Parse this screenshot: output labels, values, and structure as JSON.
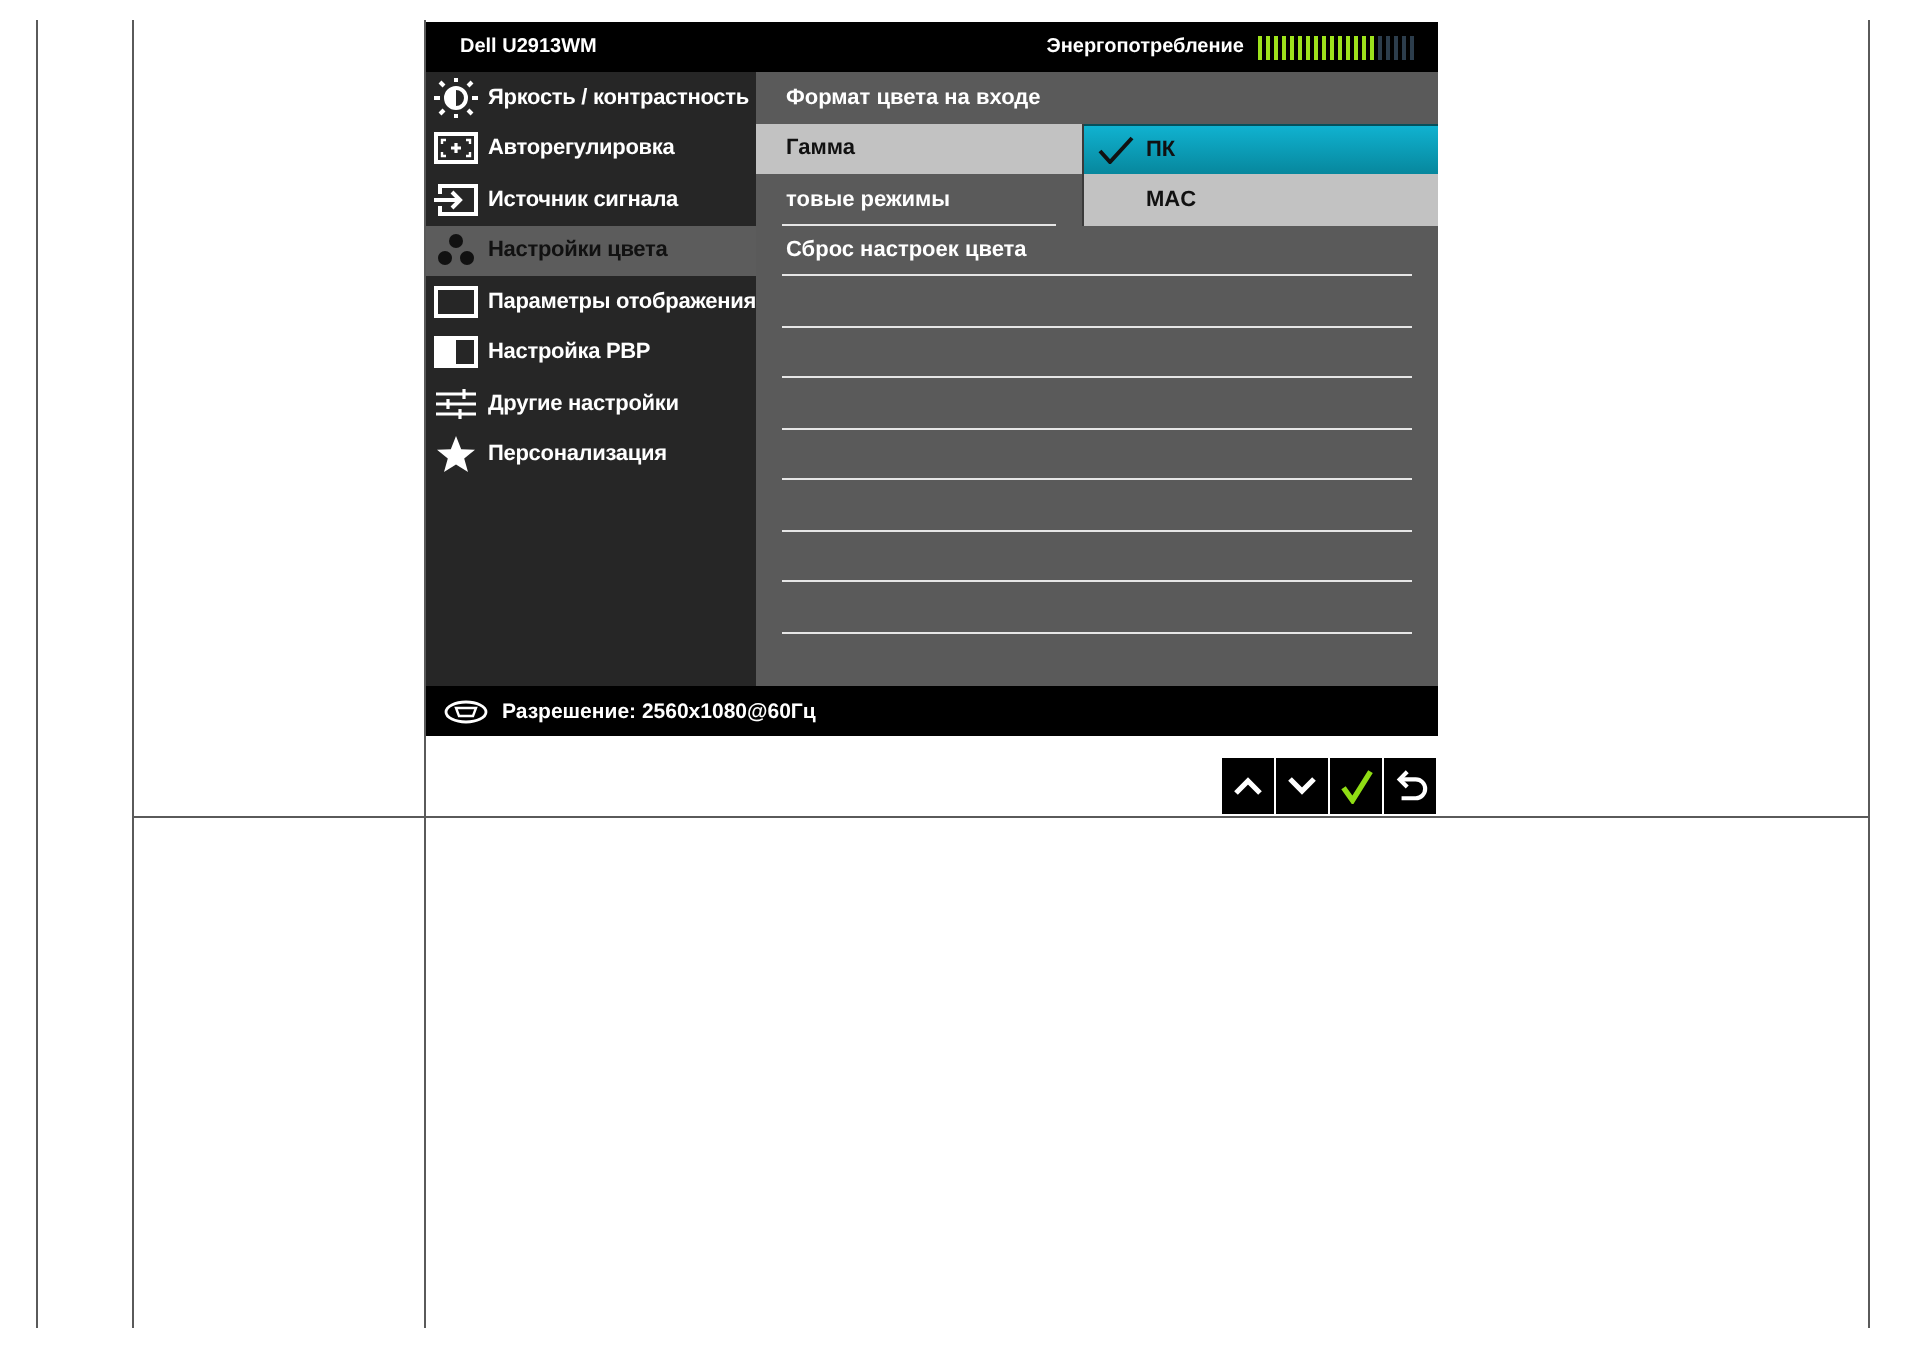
{
  "osd": {
    "model": "Dell U2913WM",
    "energy": {
      "label": "Энергопотребление",
      "level": 0.75
    },
    "menu": [
      {
        "kind": "brightness",
        "label": "Яркость / контрастность",
        "selected": false
      },
      {
        "kind": "auto",
        "label": "Авторегулировка",
        "selected": false
      },
      {
        "kind": "input",
        "label": "Источник сигнала",
        "selected": false
      },
      {
        "kind": "color",
        "label": "Настройки цвета",
        "selected": true
      },
      {
        "kind": "display",
        "label": "Параметры отображения",
        "selected": false
      },
      {
        "kind": "pbp",
        "label": "Настройка PBP",
        "selected": false
      },
      {
        "kind": "other",
        "label": "Другие настройки",
        "selected": false
      },
      {
        "kind": "personalize",
        "label": "Персонализация",
        "selected": false
      }
    ],
    "submenu": [
      {
        "label": "Формат цвета на входе",
        "selected": false
      },
      {
        "label": "Гамма",
        "selected": true
      },
      {
        "label": "товые режимы",
        "selected": false
      },
      {
        "label": "Сброс настроек цвета",
        "selected": false
      }
    ],
    "options": [
      {
        "label": "ПК",
        "selected": true
      },
      {
        "label": "MAC",
        "selected": false
      }
    ],
    "status": {
      "resolution": "Разрешение: 2560x1080@60Гц"
    }
  },
  "buttons": [
    {
      "kind": "up"
    },
    {
      "kind": "down"
    },
    {
      "kind": "ok"
    },
    {
      "kind": "back"
    }
  ]
}
